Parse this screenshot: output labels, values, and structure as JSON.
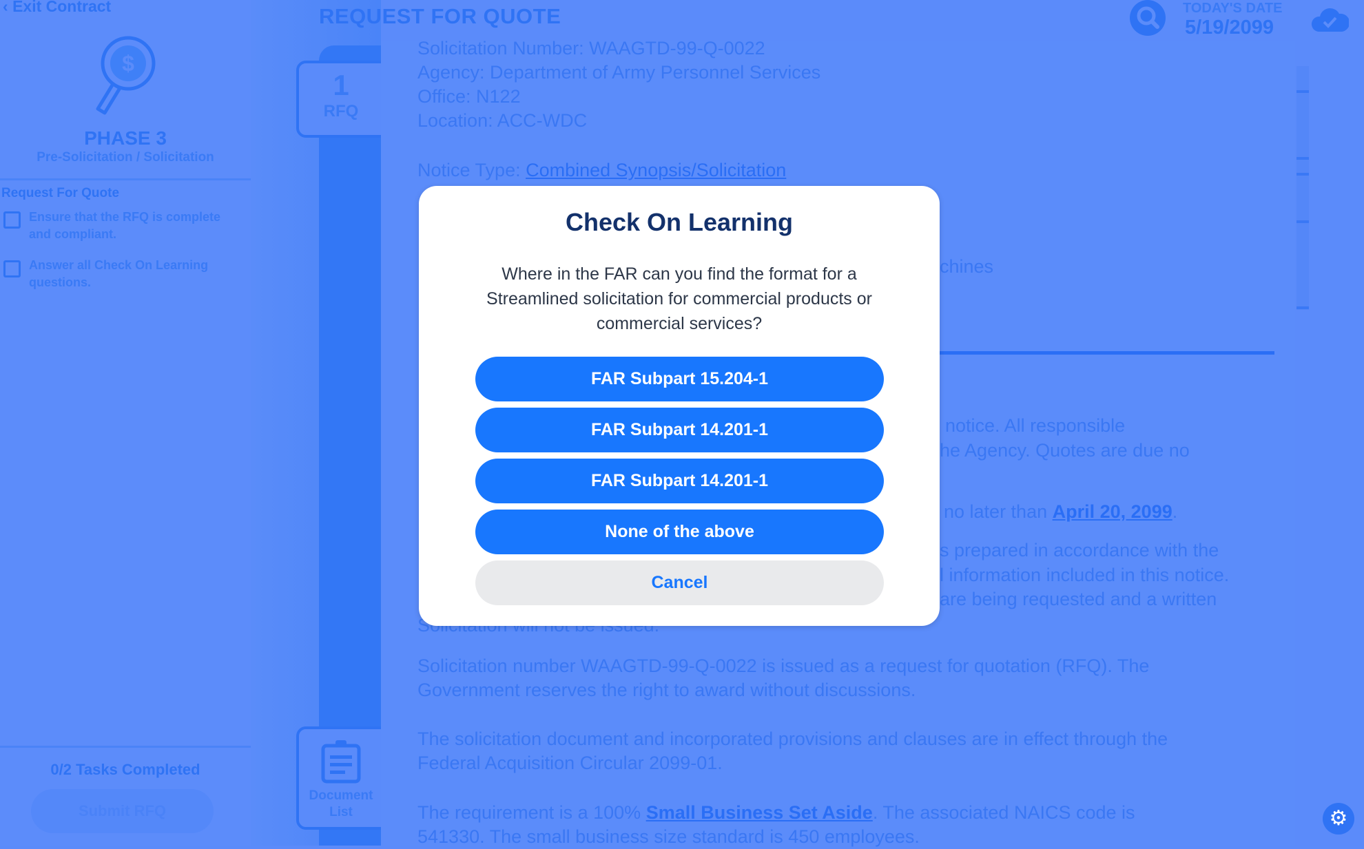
{
  "sidebar": {
    "exit": "Exit Contract",
    "phase": "PHASE 3",
    "phase_sub": "Pre-Solicitation / Solicitation",
    "section": "Request For Quote",
    "tasks": [
      "Ensure that the RFQ is complete and compliant.",
      "Answer all Check On Learning questions."
    ],
    "tasks_completed": "0/2 Tasks Completed",
    "submit": "Submit RFQ"
  },
  "tabs": {
    "rfq_number": "1",
    "rfq_label": "RFQ",
    "doc_label": "Document List"
  },
  "header": {
    "title": "REQUEST FOR QUOTE",
    "date_label": "TODAY'S DATE",
    "date": "5/19/2099"
  },
  "document": {
    "lines": [
      "Solicitation Number: WAAGTD-99-Q-0022",
      "Agency: Department of Army Personnel Services",
      "Office: N122",
      "Location: ACC-WDC"
    ],
    "notice_label": "Notice Type: ",
    "notice_link": "Combined Synopsis/Solicitation",
    "frag1": "chines",
    "frag2": "notice. All responsible",
    "frag3": "he Agency. Quotes are due no",
    "frag4": "no later than ",
    "frag4_link": "April 20, 2099",
    "frag4_end": ".",
    "frag5": "s prepared in accordance with the",
    "frag6": "l information included in this notice.",
    "frag7": "are being requested and a written",
    "frag8": "Solicitation will not be issued.",
    "p1a": "Solicitation number WAAGTD-99-Q-0022 is issued as a request for quotation (RFQ). The",
    "p1b": "Government reserves the right to award without discussions.",
    "p2a": "The solicitation document and incorporated provisions and clauses are in effect through the",
    "p2b": "Federal Acquisition Circular 2099-01.",
    "p3a_pre": "The requirement is a 100% ",
    "p3a_link": "Small Business Set Aside",
    "p3a_post": ". The associated NAICS code is",
    "p3b": "541330. The small business size standard is 450 employees."
  },
  "modal": {
    "title": "Check On Learning",
    "question": "Where in the FAR can you find the format for a Streamlined solicitation for commercial products or commercial services?",
    "options": [
      "FAR Subpart 15.204-1",
      "FAR Subpart 14.201-1",
      "FAR Subpart 14.201-1",
      "None of the above"
    ],
    "cancel": "Cancel"
  },
  "colors": {
    "primary": "#1877fe",
    "title": "#13316b",
    "overlay_bg": "#5b8bfa"
  }
}
